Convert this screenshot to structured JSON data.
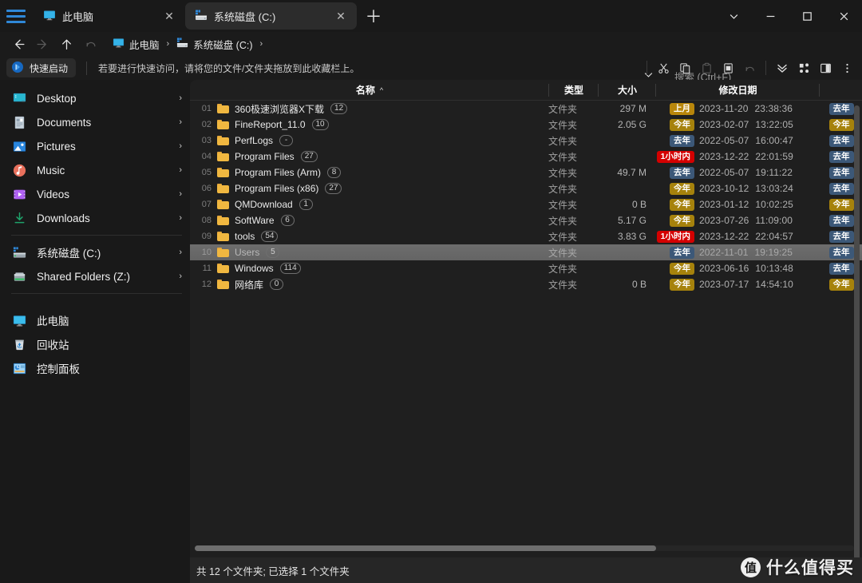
{
  "window": {
    "tabs": [
      {
        "label": "此电脑",
        "icon": "pc-icon",
        "active": false
      },
      {
        "label": "系统磁盘 (C:)",
        "icon": "drive-icon",
        "active": true
      }
    ],
    "new_tab_label": "+",
    "controls": {
      "more": "chevron-down-icon",
      "minimize": "minimize-icon",
      "maximize": "maximize-icon",
      "close": "close-icon"
    }
  },
  "nav": {
    "back": "back-arrow-icon",
    "forward": "forward-arrow-icon",
    "up": "up-arrow-icon",
    "recent": "undo-icon",
    "breadcrumb": [
      {
        "label": "此电脑",
        "icon": "pc-icon"
      },
      {
        "label": "系统磁盘 (C:)",
        "icon": "drive-icon"
      }
    ],
    "breadcrumb_sep": "›",
    "dropdown_caret": "chevron-down-icon",
    "search_placeholder": "搜索 (Ctrl+F)"
  },
  "quickaccess": {
    "chip_label": "快速启动",
    "hint": "若要进行快速访问，请将您的文件/文件夹拖放到此收藏栏上。"
  },
  "toolbar": {
    "buttons": [
      {
        "name": "cut-button",
        "icon": "scissors-icon",
        "disabled": false
      },
      {
        "name": "copy-button",
        "icon": "copy-icon",
        "disabled": false
      },
      {
        "name": "paste-button",
        "icon": "clipboard-icon",
        "disabled": true
      },
      {
        "name": "delete-button",
        "icon": "trash-icon",
        "disabled": false
      },
      {
        "name": "undo-button",
        "icon": "undo-icon",
        "disabled": true
      },
      {
        "name": "sort-button",
        "icon": "double-chevron-down-icon",
        "disabled": false
      },
      {
        "name": "view-button",
        "icon": "grid-icon",
        "disabled": false
      },
      {
        "name": "panel-button",
        "icon": "split-panel-icon",
        "disabled": false
      },
      {
        "name": "more-button",
        "icon": "kebab-menu-icon",
        "disabled": false
      }
    ]
  },
  "sidebar": {
    "groups": [
      {
        "items": [
          {
            "label": "Desktop",
            "icon": "desktop-icon",
            "chevron": "›"
          },
          {
            "label": "Documents",
            "icon": "documents-icon",
            "chevron": "›"
          },
          {
            "label": "Pictures",
            "icon": "pictures-icon",
            "chevron": "›"
          },
          {
            "label": "Music",
            "icon": "music-icon",
            "chevron": "›"
          },
          {
            "label": "Videos",
            "icon": "videos-icon",
            "chevron": "›"
          },
          {
            "label": "Downloads",
            "icon": "downloads-icon",
            "chevron": "›"
          }
        ]
      },
      {
        "items": [
          {
            "label": "系统磁盘 (C:)",
            "icon": "system-drive-icon",
            "chevron": "›"
          },
          {
            "label": "Shared Folders (Z:)",
            "icon": "shared-drive-icon",
            "chevron": "›"
          }
        ]
      },
      {
        "items": [
          {
            "label": "此电脑",
            "icon": "pc-icon",
            "chevron": ""
          },
          {
            "label": "回收站",
            "icon": "recycle-bin-icon",
            "chevron": ""
          },
          {
            "label": "控制面板",
            "icon": "control-panel-icon",
            "chevron": ""
          }
        ]
      }
    ]
  },
  "filelist": {
    "columns": {
      "name": "名称",
      "sort_indicator": "^",
      "type": "类型",
      "size": "大小",
      "date": "修改日期"
    },
    "rows": [
      {
        "index": "01",
        "name": "360极速浏览器X下载",
        "count": "12",
        "type": "文件夹",
        "size": "297 M",
        "badge": "上月",
        "badge_kind": "b-lastmonth",
        "date": "2023-11-20",
        "time": "23:38:36",
        "badge2": "去年",
        "badge2_kind": "b-lastyear",
        "selected": false
      },
      {
        "index": "02",
        "name": "FineReport_11.0",
        "count": "10",
        "type": "文件夹",
        "size": "2.05 G",
        "badge": "今年",
        "badge_kind": "b-thisyear",
        "date": "2023-02-07",
        "time": "13:22:05",
        "badge2": "今年",
        "badge2_kind": "b-thisyear",
        "selected": false
      },
      {
        "index": "03",
        "name": "PerfLogs",
        "count": "-",
        "type": "文件夹",
        "size": "",
        "badge": "去年",
        "badge_kind": "b-lastyear",
        "date": "2022-05-07",
        "time": "16:00:47",
        "badge2": "去年",
        "badge2_kind": "b-lastyear",
        "selected": false
      },
      {
        "index": "04",
        "name": "Program Files",
        "count": "27",
        "type": "文件夹",
        "size": "",
        "badge": "1小时内",
        "badge_kind": "b-hour",
        "date": "2023-12-22",
        "time": "22:01:59",
        "badge2": "去年",
        "badge2_kind": "b-lastyear",
        "selected": false
      },
      {
        "index": "05",
        "name": "Program Files (Arm)",
        "count": "8",
        "type": "文件夹",
        "size": "49.7 M",
        "badge": "去年",
        "badge_kind": "b-lastyear",
        "date": "2022-05-07",
        "time": "19:11:22",
        "badge2": "去年",
        "badge2_kind": "b-lastyear",
        "selected": false
      },
      {
        "index": "06",
        "name": "Program Files (x86)",
        "count": "27",
        "type": "文件夹",
        "size": "",
        "badge": "今年",
        "badge_kind": "b-thisyear",
        "date": "2023-10-12",
        "time": "13:03:24",
        "badge2": "去年",
        "badge2_kind": "b-lastyear",
        "selected": false
      },
      {
        "index": "07",
        "name": "QMDownload",
        "count": "1",
        "type": "文件夹",
        "size": "0 B",
        "badge": "今年",
        "badge_kind": "b-thisyear",
        "date": "2023-01-12",
        "time": "10:02:25",
        "badge2": "今年",
        "badge2_kind": "b-thisyear",
        "selected": false
      },
      {
        "index": "08",
        "name": "SoftWare",
        "count": "6",
        "type": "文件夹",
        "size": "5.17 G",
        "badge": "今年",
        "badge_kind": "b-thisyear",
        "date": "2023-07-26",
        "time": "11:09:00",
        "badge2": "去年",
        "badge2_kind": "b-lastyear",
        "selected": false
      },
      {
        "index": "09",
        "name": "tools",
        "count": "54",
        "type": "文件夹",
        "size": "3.83 G",
        "badge": "1小时内",
        "badge_kind": "b-hour",
        "date": "2023-12-22",
        "time": "22:04:57",
        "badge2": "去年",
        "badge2_kind": "b-lastyear",
        "selected": false
      },
      {
        "index": "10",
        "name": "Users",
        "count": "5",
        "type": "文件夹",
        "size": "",
        "badge": "去年",
        "badge_kind": "b-lastyear",
        "date": "2022-11-01",
        "time": "19:19:25",
        "badge2": "去年",
        "badge2_kind": "b-lastyear",
        "selected": true
      },
      {
        "index": "11",
        "name": "Windows",
        "count": "114",
        "type": "文件夹",
        "size": "",
        "badge": "今年",
        "badge_kind": "b-thisyear",
        "date": "2023-06-16",
        "time": "10:13:48",
        "badge2": "去年",
        "badge2_kind": "b-lastyear",
        "selected": false
      },
      {
        "index": "12",
        "name": "网络库",
        "count": "0",
        "type": "文件夹",
        "size": "0 B",
        "badge": "今年",
        "badge_kind": "b-thisyear",
        "date": "2023-07-17",
        "time": "14:54:10",
        "badge2": "今年",
        "badge2_kind": "b-thisyear",
        "selected": false
      }
    ]
  },
  "statusbar": {
    "text": "共 12 个文件夹; 已选择 1 个文件夹"
  },
  "watermark": {
    "logo": "值",
    "text": "什么值得买"
  },
  "colors": {
    "accent": "#2f88d8",
    "badge_lastmonth": "#b8860b",
    "badge_thisyear": "#a6820c",
    "badge_lastyear": "#3c5878",
    "badge_hour": "#d40000",
    "folder": "#f0b740",
    "window_bg": "#191919",
    "content_bg": "#1f1f1f"
  }
}
